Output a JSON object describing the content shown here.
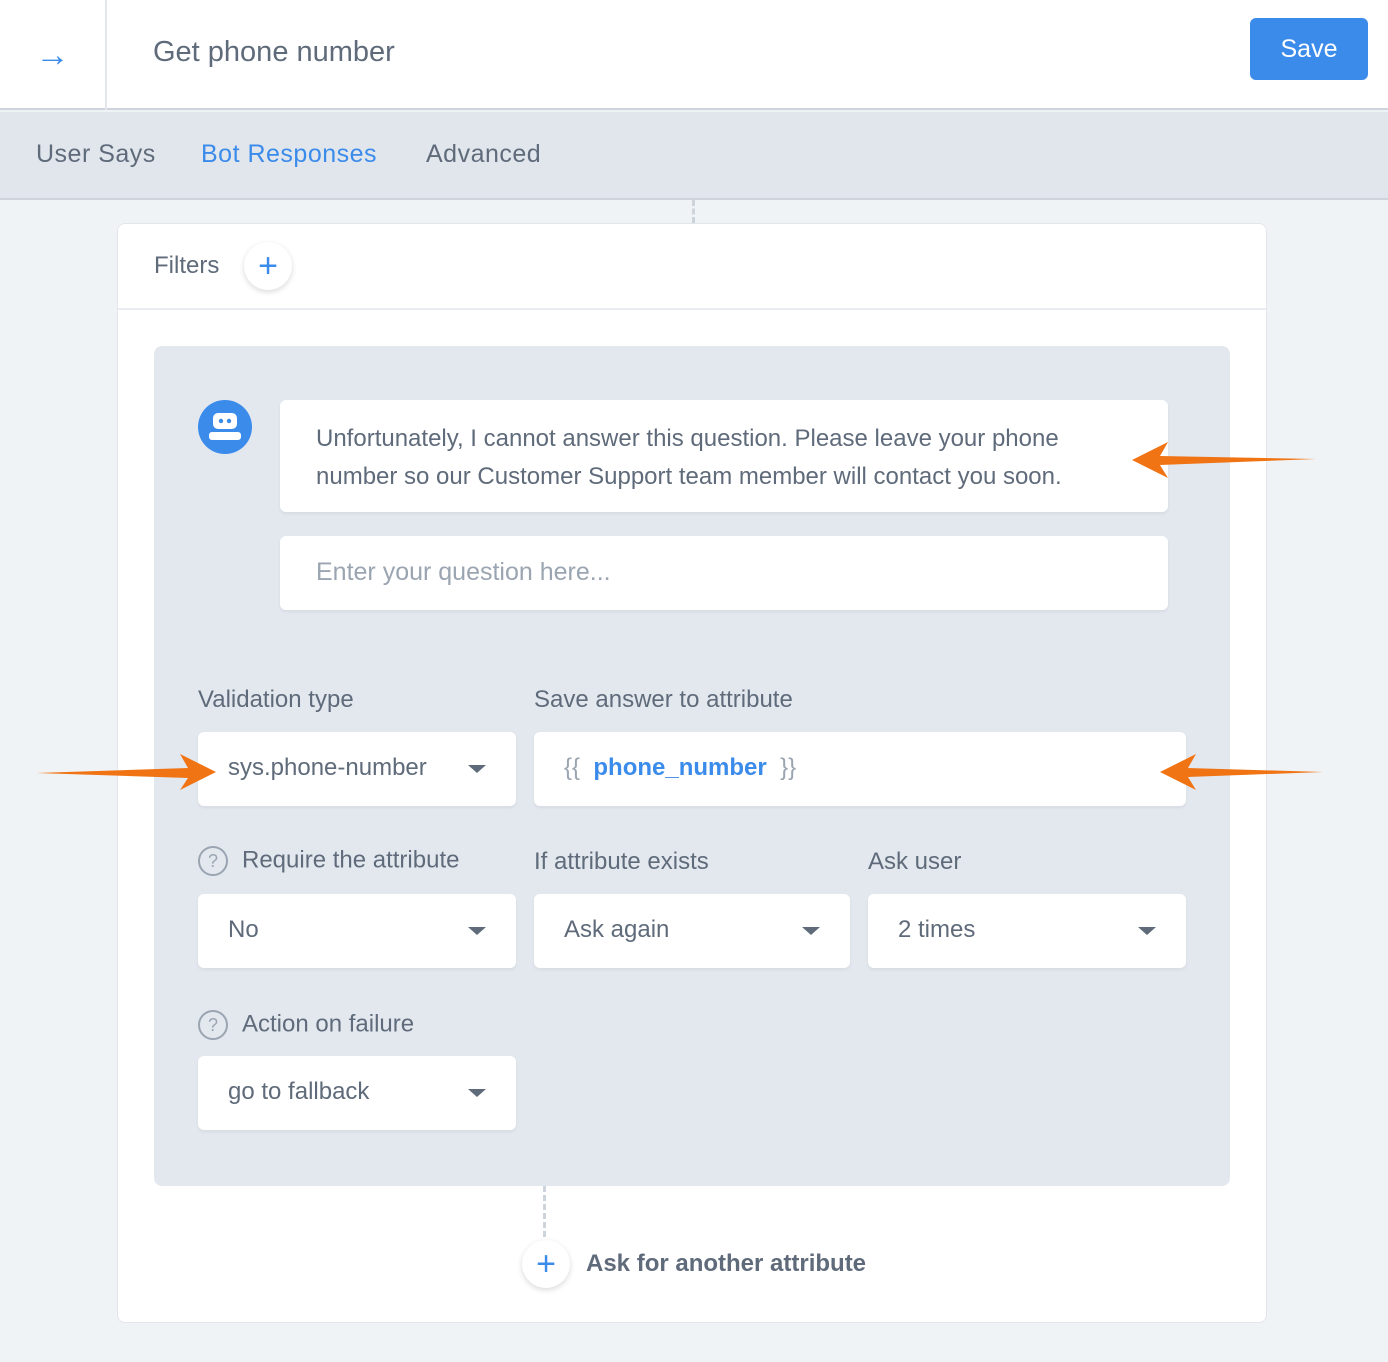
{
  "header": {
    "title": "Get phone number",
    "save_label": "Save"
  },
  "tabs": [
    {
      "label": "User Says"
    },
    {
      "label": "Bot Responses"
    },
    {
      "label": "Advanced"
    }
  ],
  "filters": {
    "label": "Filters"
  },
  "bot_message": "Unfortunately, I cannot answer this question. Please leave your phone number so our Customer Support team member will contact you soon.",
  "question_input": {
    "placeholder": "Enter your question here..."
  },
  "validation": {
    "label": "Validation type",
    "value": "sys.phone-number"
  },
  "save_attribute": {
    "label": "Save answer to attribute",
    "open": "{{",
    "value": "phone_number",
    "close": "}}"
  },
  "require": {
    "label": "Require the attribute",
    "value": "No"
  },
  "exists": {
    "label": "If attribute exists",
    "value": "Ask again"
  },
  "ask_user": {
    "label": "Ask user",
    "value": "2 times"
  },
  "failure": {
    "label": "Action on failure",
    "value": "go to fallback"
  },
  "add_attribute": {
    "label": "Ask for another attribute"
  },
  "colors": {
    "accent": "#3b8beb",
    "annotation": "#f07414"
  }
}
